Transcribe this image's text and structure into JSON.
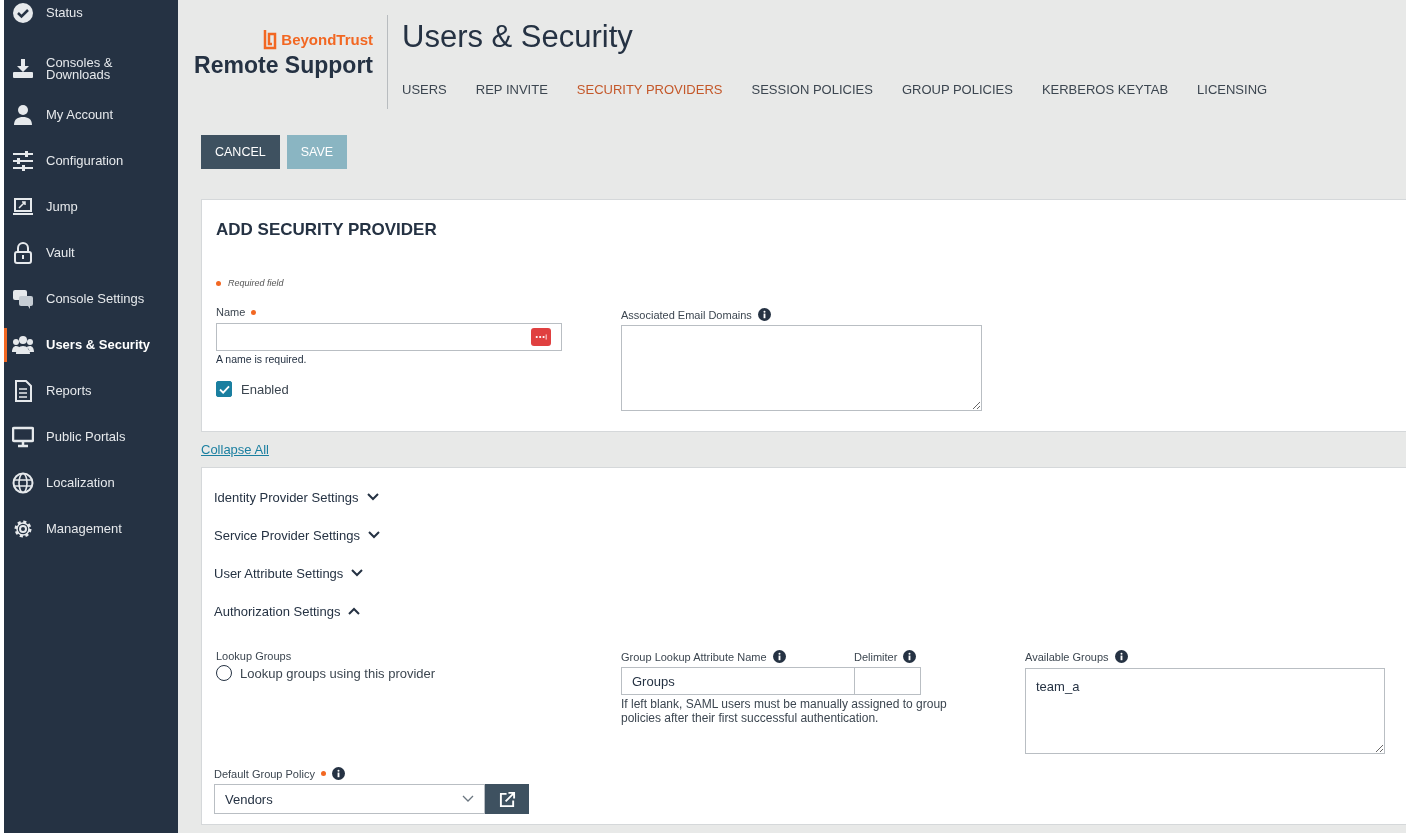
{
  "sidebar": {
    "items": [
      {
        "label": "Status",
        "selected": false
      },
      {
        "label": "Consoles & Downloads",
        "selected": false
      },
      {
        "label": "My Account",
        "selected": false
      },
      {
        "label": "Configuration",
        "selected": false
      },
      {
        "label": "Jump",
        "selected": false
      },
      {
        "label": "Vault",
        "selected": false
      },
      {
        "label": "Console Settings",
        "selected": false
      },
      {
        "label": "Users & Security",
        "selected": true
      },
      {
        "label": "Reports",
        "selected": false
      },
      {
        "label": "Public Portals",
        "selected": false
      },
      {
        "label": "Localization",
        "selected": false
      },
      {
        "label": "Management",
        "selected": false
      }
    ]
  },
  "header": {
    "brand": "BeyondTrust",
    "product": "Remote Support",
    "page_title": "Users & Security"
  },
  "tabs": [
    {
      "label": "USERS",
      "selected": false
    },
    {
      "label": "REP INVITE",
      "selected": false
    },
    {
      "label": "SECURITY PROVIDERS",
      "selected": true
    },
    {
      "label": "SESSION POLICIES",
      "selected": false
    },
    {
      "label": "GROUP POLICIES",
      "selected": false
    },
    {
      "label": "KERBEROS KEYTAB",
      "selected": false
    },
    {
      "label": "LICENSING",
      "selected": false
    }
  ],
  "buttons": [
    {
      "label": "CANCEL",
      "disabled": false
    },
    {
      "label": "SAVE",
      "disabled": true
    }
  ],
  "form": {
    "title": "ADD SECURITY PROVIDER",
    "required_note": "Required field",
    "name": {
      "label": "Name",
      "error": "A name is required."
    },
    "enabled": {
      "label": "Enabled",
      "checked": true
    },
    "email_domains": {
      "label": "Associated Email Domains"
    }
  },
  "collapse_link": "Collapse All",
  "sections": [
    {
      "label": "Identity Provider Settings",
      "expanded": false
    },
    {
      "label": "Service Provider Settings",
      "expanded": false
    },
    {
      "label": "User Attribute Settings",
      "expanded": false
    },
    {
      "label": "Authorization Settings",
      "expanded": true
    }
  ],
  "authorization": {
    "lookup_label": "Lookup Groups",
    "lookup_option": {
      "label": "Lookup groups using this provider",
      "selected": false
    },
    "attribute": {
      "label": "Group Lookup Attribute Name",
      "value": "Groups"
    },
    "delimiter": {
      "label": "Delimiter"
    },
    "help": "If left blank, SAML users must be manually assigned to group policies after their first successful authentication.",
    "available": {
      "label": "Available Groups",
      "value": "team_a"
    },
    "default_policy": {
      "label": "Default Group Policy",
      "value": "Vendors"
    }
  }
}
